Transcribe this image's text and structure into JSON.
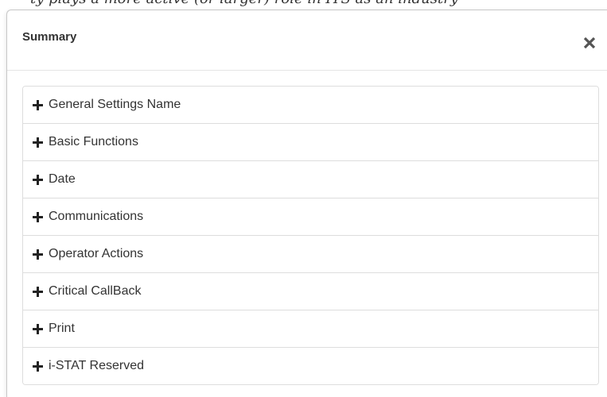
{
  "page": {
    "top_partial_text": "ty plays a more active (or larger) role in ITS as an industry"
  },
  "modal": {
    "title": "Summary",
    "close_label": "×",
    "sections": [
      {
        "label": "General Settings Name",
        "icon": "plus-icon"
      },
      {
        "label": "Basic Functions",
        "icon": "plus-icon"
      },
      {
        "label": "Date",
        "icon": "plus-icon"
      },
      {
        "label": "Communications",
        "icon": "plus-icon"
      },
      {
        "label": "Operator Actions",
        "icon": "plus-icon"
      },
      {
        "label": "Critical CallBack",
        "icon": "plus-icon"
      },
      {
        "label": "Print",
        "icon": "plus-icon"
      },
      {
        "label": "i-STAT Reserved",
        "icon": "plus-icon"
      }
    ]
  },
  "colors": {
    "text": "#333333",
    "border": "#dddddd",
    "close_icon": "#555555"
  }
}
